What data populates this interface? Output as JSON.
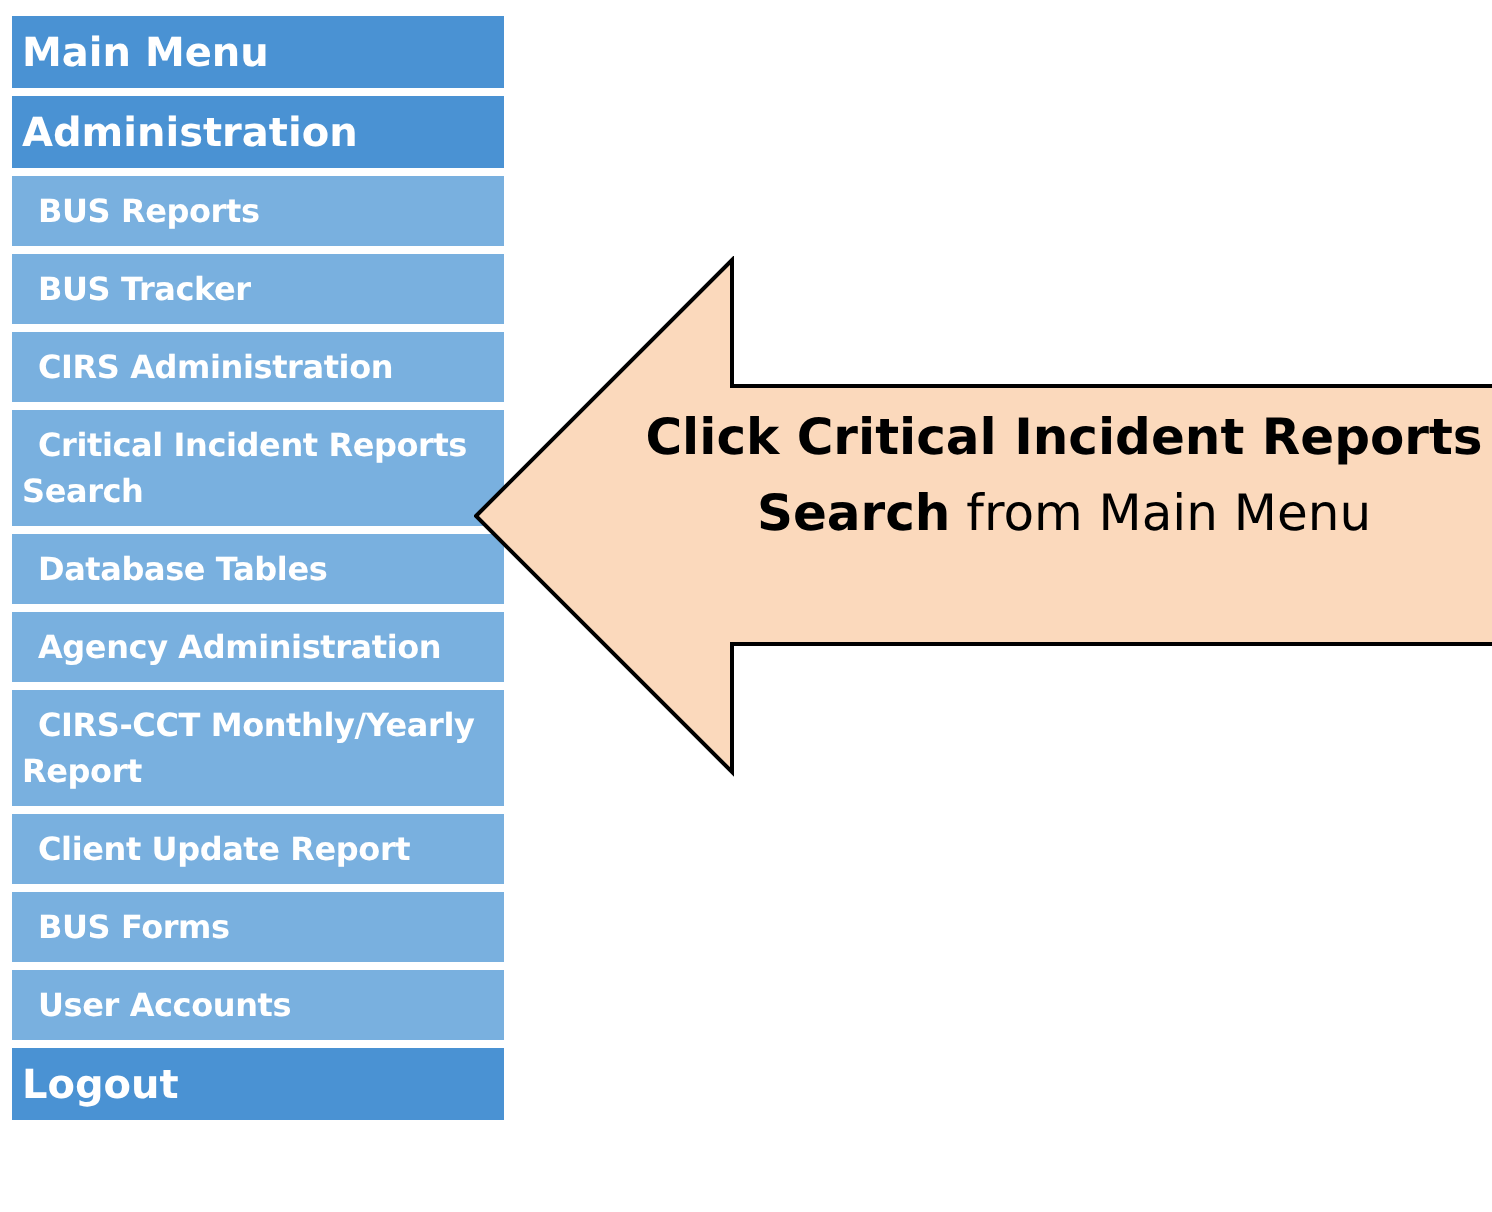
{
  "menu": [
    {
      "label": "Main Menu",
      "kind": "header"
    },
    {
      "label": "Administration",
      "kind": "header"
    },
    {
      "label": "BUS Reports",
      "kind": "item"
    },
    {
      "label": "BUS Tracker",
      "kind": "item"
    },
    {
      "label": "CIRS Administration",
      "kind": "item"
    },
    {
      "label": "Critical Incident Reports Search",
      "kind": "item"
    },
    {
      "label": "Database Tables",
      "kind": "item"
    },
    {
      "label": "Agency Administration",
      "kind": "item"
    },
    {
      "label": "CIRS-CCT Monthly/Yearly Report",
      "kind": "item"
    },
    {
      "label": "Client Update Report",
      "kind": "item"
    },
    {
      "label": "BUS Forms",
      "kind": "item"
    },
    {
      "label": "User Accounts",
      "kind": "item"
    },
    {
      "label": "Logout",
      "kind": "header"
    }
  ],
  "callout": {
    "text": "**Click Critical Incident Reports Search** from Main Menu"
  }
}
